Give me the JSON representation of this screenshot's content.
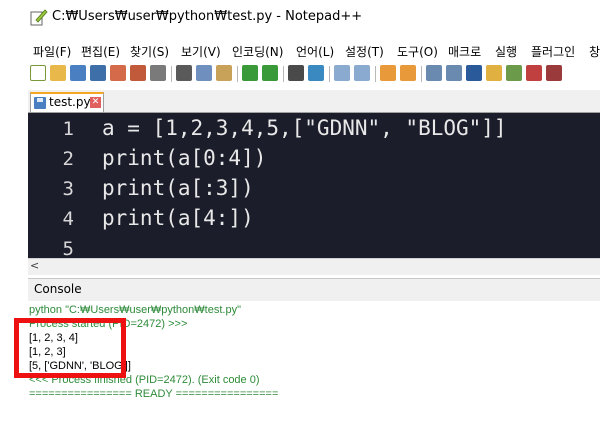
{
  "window": {
    "title": "C:₩Users₩user₩python₩test.py - Notepad++"
  },
  "menu": [
    "파일(F)",
    "편집(E)",
    "찾기(S)",
    "보기(V)",
    "인코딩(N)",
    "언어(L)",
    "설정(T)",
    "도구(O)",
    "매크로",
    "실행",
    "플러그인",
    "창"
  ],
  "toolbar_icons": [
    "new-file-icon",
    "open-file-icon",
    "save-icon",
    "save-all-icon",
    "close-icon",
    "close-all-icon",
    "print-icon",
    "cut-icon",
    "copy-icon",
    "paste-icon",
    "undo-icon",
    "redo-icon",
    "find-icon",
    "replace-icon",
    "zoom-in-icon",
    "zoom-out-icon",
    "sync-v-icon",
    "sync-h-icon",
    "word-wrap-icon",
    "show-all-chars-icon",
    "indent-guide-icon",
    "doc-map-icon",
    "function-list-icon",
    "folder-workspace-icon",
    "record-macro-icon"
  ],
  "tab": {
    "label": "test.py",
    "close": "✕"
  },
  "editor": {
    "lines": [
      {
        "num": "1",
        "code": "a = [1,2,3,4,5,[\"GDNN\", \"BLOG\"]]"
      },
      {
        "num": "2",
        "code": "print(a[0:4])"
      },
      {
        "num": "3",
        "code": "print(a[:3])"
      },
      {
        "num": "4",
        "code": "print(a[4:])"
      },
      {
        "num": "5",
        "code": ""
      }
    ]
  },
  "scroll_arrow": "<",
  "console": {
    "label": "Console",
    "lines": [
      {
        "text": "python \"C:₩Users₩user₩python₩test.py\"",
        "color": "green"
      },
      {
        "text": "Process started (PID=2472) >>>",
        "color": "green"
      },
      {
        "text": "[1, 2, 3, 4]",
        "color": "black"
      },
      {
        "text": "[1, 2, 3]",
        "color": "black"
      },
      {
        "text": "[5, ['GDNN', 'BLOG']]",
        "color": "black"
      },
      {
        "text": "<<< Process finished (PID=2472). (Exit code 0)",
        "color": "green"
      },
      {
        "text": "================ READY ================",
        "color": "green"
      }
    ]
  },
  "colors": {
    "highlight": "#ee1111",
    "editor_bg": "#1b1d2b",
    "console_green": "#2e8b3a"
  }
}
